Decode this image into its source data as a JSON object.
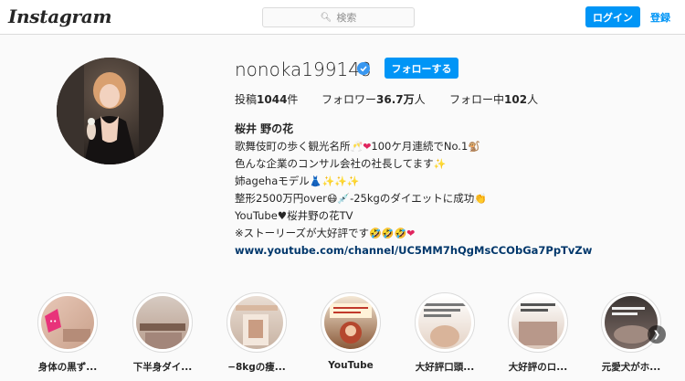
{
  "header": {
    "logo": "Instagram",
    "search_placeholder": "検索",
    "login_label": "ログイン",
    "signup_label": "登録"
  },
  "profile": {
    "username": "nonoka199148",
    "follow_label": "フォローする",
    "stats": {
      "posts_prefix": "投稿",
      "posts_value": "1044",
      "posts_suffix": "件",
      "followers_prefix": "フォロワー",
      "followers_value": "36.7万",
      "followers_suffix": "人",
      "following_prefix": "フォロー中",
      "following_value": "102",
      "following_suffix": "人"
    },
    "bio": {
      "name": "桜井 野の花",
      "line1": "歌舞伎町の歩く観光名所",
      "line1b": "100ケ月連続でNo.1",
      "line2": "色んな企業のコンサル会社の社長してます",
      "line3": "姉agehaモデル",
      "line4a": "整形2500万円over",
      "line4b": "-25kgのダイエットに成功",
      "line5": "YouTube♥桜井野の花TV",
      "line6": "※ストーリーズが大好評です",
      "link": "www.youtube.com/channel/UC5MM7hQgMsCCObGa7PpTvZw"
    }
  },
  "highlights": [
    {
      "label": "身体の黒ず..."
    },
    {
      "label": "下半身ダイ..."
    },
    {
      "label": "−8kgの痩..."
    },
    {
      "label": "YouTube"
    },
    {
      "label": "大好評口頭..."
    },
    {
      "label": "大好評のロ..."
    },
    {
      "label": "元愛犬がホ..."
    }
  ]
}
